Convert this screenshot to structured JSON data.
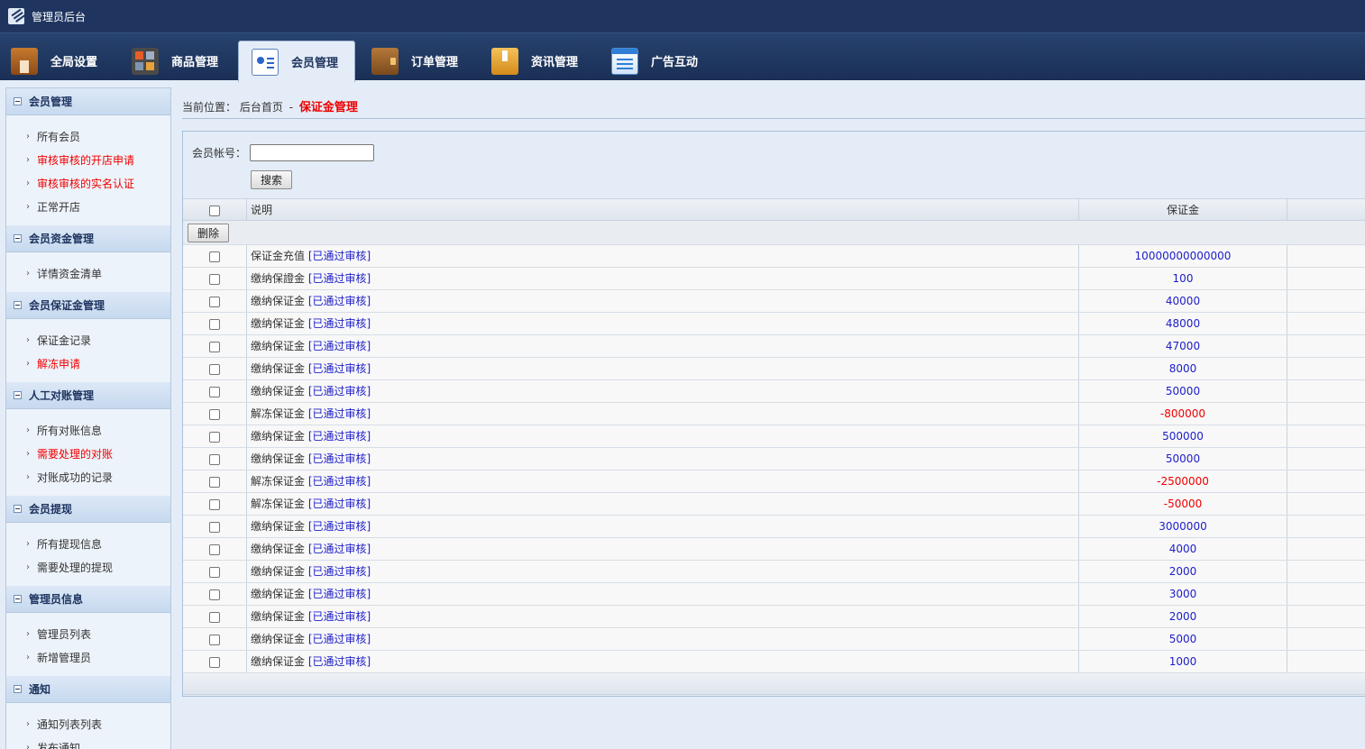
{
  "app": {
    "title": "管理员后台"
  },
  "tabs": [
    {
      "label": "全局设置",
      "icon": "settings-home-icon"
    },
    {
      "label": "商品管理",
      "icon": "goods-grid-icon"
    },
    {
      "label": "会员管理",
      "icon": "member-card-icon",
      "active": true
    },
    {
      "label": "订单管理",
      "icon": "wallet-icon"
    },
    {
      "label": "资讯管理",
      "icon": "bookmark-box-icon"
    },
    {
      "label": "广告互动",
      "icon": "document-list-icon"
    }
  ],
  "sidebar": {
    "sections": [
      {
        "title": "会员管理",
        "items": [
          {
            "label": "所有会员",
            "highlight": false
          },
          {
            "label": "审核审核的开店申请",
            "highlight": true
          },
          {
            "label": "审核审核的实名认证",
            "highlight": true
          },
          {
            "label": "正常开店",
            "highlight": false
          }
        ]
      },
      {
        "title": "会员资金管理",
        "items": [
          {
            "label": "详情资金清单",
            "highlight": false
          }
        ]
      },
      {
        "title": "会员保证金管理",
        "items": [
          {
            "label": "保证金记录",
            "highlight": false
          },
          {
            "label": "解冻申请",
            "highlight": true
          }
        ]
      },
      {
        "title": "人工对账管理",
        "items": [
          {
            "label": "所有对账信息",
            "highlight": false
          },
          {
            "label": "需要处理的对账",
            "highlight": true
          },
          {
            "label": "对账成功的记录",
            "highlight": false
          }
        ]
      },
      {
        "title": "会员提现",
        "items": [
          {
            "label": "所有提现信息",
            "highlight": false
          },
          {
            "label": "需要处理的提现",
            "highlight": false
          }
        ]
      },
      {
        "title": "管理员信息",
        "items": [
          {
            "label": "管理员列表",
            "highlight": false
          },
          {
            "label": "新增管理员",
            "highlight": false
          }
        ]
      },
      {
        "title": "通知",
        "items": [
          {
            "label": "通知列表列表",
            "highlight": false
          },
          {
            "label": "发布通知",
            "highlight": false
          }
        ]
      }
    ]
  },
  "breadcrumb": {
    "prefix": "当前位置：",
    "home": "后台首页",
    "separator": "-",
    "current": "保证金管理"
  },
  "search": {
    "label": "会员帐号：",
    "value": "",
    "button": "搜索"
  },
  "table": {
    "headers": {
      "description": "说明",
      "amount": "保证金"
    },
    "delete_button": "删除",
    "rows": [
      {
        "desc": "保证金充值",
        "status": "[已通过审核]",
        "amount": "10000000000000",
        "negative": false
      },
      {
        "desc": "缴纳保證金",
        "status": "[已通过审核]",
        "amount": "100",
        "negative": false
      },
      {
        "desc": "缴纳保证金",
        "status": "[已通过审核]",
        "amount": "40000",
        "negative": false
      },
      {
        "desc": "缴纳保证金",
        "status": "[已通过审核]",
        "amount": "48000",
        "negative": false
      },
      {
        "desc": "缴纳保证金",
        "status": "[已通过审核]",
        "amount": "47000",
        "negative": false
      },
      {
        "desc": "缴纳保证金",
        "status": "[已通过审核]",
        "amount": "8000",
        "negative": false
      },
      {
        "desc": "缴纳保证金",
        "status": "[已通过审核]",
        "amount": "50000",
        "negative": false
      },
      {
        "desc": "解冻保证金",
        "status": "[已通过审核]",
        "amount": "-800000",
        "negative": true
      },
      {
        "desc": "缴纳保证金",
        "status": "[已通过审核]",
        "amount": "500000",
        "negative": false
      },
      {
        "desc": "缴纳保证金",
        "status": "[已通过审核]",
        "amount": "50000",
        "negative": false
      },
      {
        "desc": "解冻保证金",
        "status": "[已通过审核]",
        "amount": "-2500000",
        "negative": true
      },
      {
        "desc": "解冻保证金",
        "status": "[已通过审核]",
        "amount": "-50000",
        "negative": true
      },
      {
        "desc": "缴纳保证金",
        "status": "[已通过审核]",
        "amount": "3000000",
        "negative": false
      },
      {
        "desc": "缴纳保证金",
        "status": "[已通过审核]",
        "amount": "4000",
        "negative": false
      },
      {
        "desc": "缴纳保证金",
        "status": "[已通过审核]",
        "amount": "2000",
        "negative": false
      },
      {
        "desc": "缴纳保证金",
        "status": "[已通过审核]",
        "amount": "3000",
        "negative": false
      },
      {
        "desc": "缴纳保证金",
        "status": "[已通过审核]",
        "amount": "2000",
        "negative": false
      },
      {
        "desc": "缴纳保证金",
        "status": "[已通过审核]",
        "amount": "5000",
        "negative": false
      },
      {
        "desc": "缴纳保证金",
        "status": "[已通过审核]",
        "amount": "1000",
        "negative": false
      }
    ]
  },
  "colors": {
    "header_bg": "#1f3560",
    "accent_red": "#ee0000",
    "link_blue": "#1d1dc8",
    "panel_bg": "#e4edf7"
  }
}
